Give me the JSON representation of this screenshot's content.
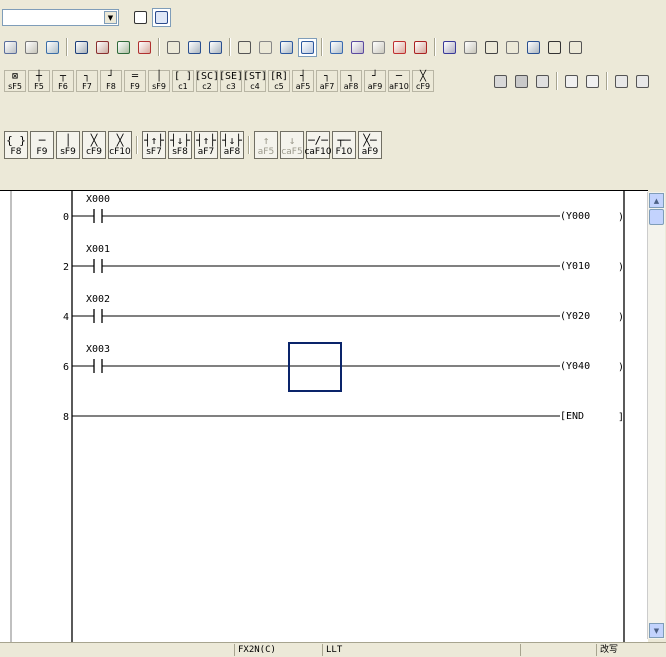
{
  "toolbar_top": {
    "device_combo_value": "",
    "icons": [
      "copy-icon",
      "paste-icon",
      "undo-icon",
      "find-device-icon",
      "find-instruction-icon",
      "find-contact-icon",
      "replace-device-icon",
      "replace-instruction-icon",
      "zoom-in-icon",
      "zoom-out-icon",
      "monitor-icon",
      "monitor-write-icon",
      "ladder-view-icon",
      "list-view-icon",
      "sfc-view-icon",
      "device-search-icon",
      "edit-mode-icon",
      "read-mode-icon",
      "monitor-mode-icon",
      "write-plc-icon",
      "read-plc-icon",
      "verify-icon",
      "program-check-icon",
      "device-batch-icon",
      "comment-icon",
      "statement-icon"
    ]
  },
  "fkeys_row1": [
    {
      "sym": "⊠",
      "label": "sF5"
    },
    {
      "sym": "┼",
      "label": "F5"
    },
    {
      "sym": "┬",
      "label": "F6"
    },
    {
      "sym": "┐",
      "label": "F7"
    },
    {
      "sym": "┘",
      "label": "F8"
    },
    {
      "sym": "═",
      "label": "F9"
    },
    {
      "sym": "│",
      "label": "sF9"
    },
    {
      "sym": "[ ]",
      "label": "c1"
    },
    {
      "sym": "[SC]",
      "label": "c2"
    },
    {
      "sym": "[SE]",
      "label": "c3"
    },
    {
      "sym": "[ST]",
      "label": "c4"
    },
    {
      "sym": "[R]",
      "label": "c5"
    },
    {
      "sym": "┤",
      "label": "aF5"
    },
    {
      "sym": "┐",
      "label": "aF7"
    },
    {
      "sym": "┐",
      "label": "aF8"
    },
    {
      "sym": "┘",
      "label": "aF9"
    },
    {
      "sym": "─",
      "label": "aF10"
    },
    {
      "sym": "╳",
      "label": "cF9"
    }
  ],
  "fkeys_row2": [
    {
      "sym": "{ }",
      "label": "F8",
      "dim": false
    },
    {
      "sym": "─",
      "label": "F9",
      "dim": false
    },
    {
      "sym": "│",
      "label": "sF9",
      "dim": false
    },
    {
      "sym": "╳",
      "label": "cF9",
      "dim": false
    },
    {
      "sym": "╳",
      "label": "cF10",
      "dim": false
    },
    {
      "sym": "┤↑├",
      "label": "sF7",
      "dim": false
    },
    {
      "sym": "┤↓├",
      "label": "sF8",
      "dim": false
    },
    {
      "sym": "┤↑├",
      "label": "aF7",
      "dim": false
    },
    {
      "sym": "┤↓├",
      "label": "aF8",
      "dim": false
    },
    {
      "sym": "↑",
      "label": "aF5",
      "dim": true
    },
    {
      "sym": "↓",
      "label": "caF5",
      "dim": true
    },
    {
      "sym": "─/─",
      "label": "caF10",
      "dim": false
    },
    {
      "sym": "┬─",
      "label": "F10",
      "dim": false
    },
    {
      "sym": "╳─",
      "label": "aF9",
      "dim": false
    }
  ],
  "rungs": [
    {
      "step": "0",
      "contact": "X000",
      "coil": "(Y000",
      "coil_end": ")"
    },
    {
      "step": "2",
      "contact": "X001",
      "coil": "(Y010",
      "coil_end": ")"
    },
    {
      "step": "4",
      "contact": "X002",
      "coil": "(Y020",
      "coil_end": ")"
    },
    {
      "step": "6",
      "contact": "X003",
      "coil": "(Y040",
      "coil_end": ")"
    },
    {
      "step": "8",
      "contact": "",
      "coil": "[END",
      "coil_end": "]"
    }
  ],
  "status": {
    "plc_type": "FX2N(C)",
    "connection": "LLT",
    "mode": "改写"
  },
  "colors": {
    "cursor": "#0a246a",
    "face": "#ece9d8",
    "line": "#000000"
  }
}
